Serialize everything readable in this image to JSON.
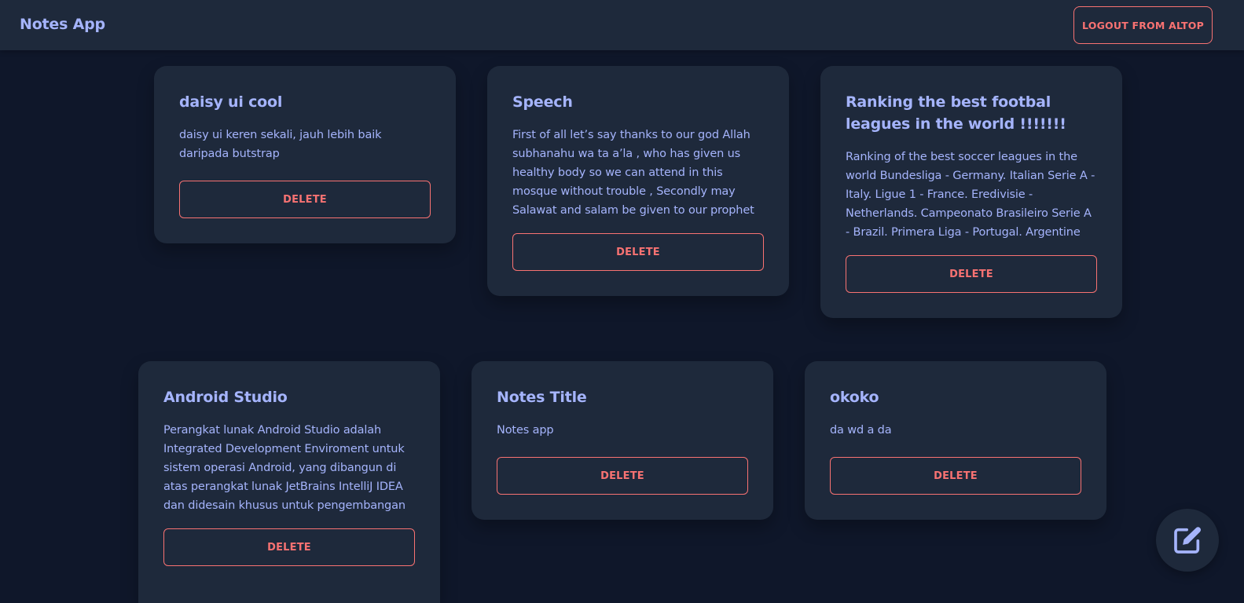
{
  "navbar": {
    "brand": "Notes App",
    "logout_label": "LOGOUT FROM ALTOP"
  },
  "notes": [
    {
      "title": "daisy ui cool",
      "body": "daisy ui keren sekali, jauh lebih baik daripada butstrap",
      "delete_label": "DELETE"
    },
    {
      "title": "Speech",
      "body": "First of all let’s say thanks to our god Allah subhanahu wa ta a’la , who has given us healthy body so we can attend in this mosque without trouble , Secondly may Salawat and salam be given to our prophet Muhammad",
      "delete_label": "DELETE"
    },
    {
      "title": "Ranking the best footbal leagues in the world !!!!!!!",
      "body": "Ranking of the best soccer leagues in the world Bundesliga - Germany. Italian Serie A - Italy. Ligue 1 - France. Eredivisie - Netherlands. Campeonato Brasileiro Serie A - Brazil. Primera Liga - Portugal. Argentine Primera Division - Argentina. Major League",
      "delete_label": "DELETE"
    },
    {
      "title": "Android Studio",
      "body": "Perangkat lunak Android Studio adalah Integrated Development Enviroment untuk sistem operasi Android, yang dibangun di atas perangkat lunak JetBrains IntelliJ IDEA dan didesain khusus untuk pengembangan Android.",
      "delete_label": "DELETE"
    },
    {
      "title": "Notes Title",
      "body": "Notes app",
      "delete_label": "DELETE"
    },
    {
      "title": "okoko",
      "body": "da wd a da",
      "delete_label": "DELETE"
    }
  ],
  "fab": {
    "icon": "edit-note-icon"
  },
  "colors": {
    "background": "#0f172a",
    "surface": "#1e293b",
    "title": "#a5b4fc",
    "accent": "#f87272"
  }
}
